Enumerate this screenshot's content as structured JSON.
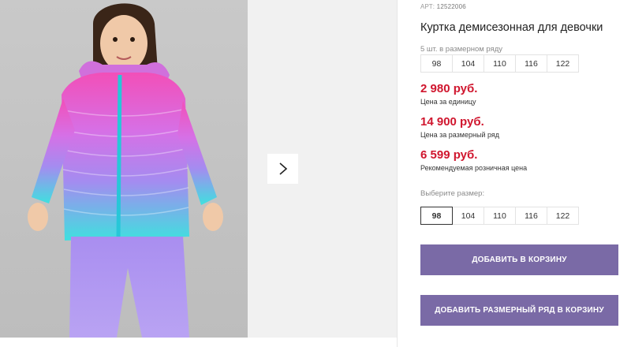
{
  "product": {
    "article_label": "АРТ:",
    "article_number": "12522006",
    "title": "Куртка демисезонная для девочки",
    "size_row_caption": "5 шт. в размерном ряду",
    "size_row": [
      "98",
      "104",
      "110",
      "116",
      "122"
    ],
    "prices": [
      {
        "value": "2 980 руб.",
        "caption": "Цена за единицу"
      },
      {
        "value": "14 900 руб.",
        "caption": "Цена за размерный ряд"
      },
      {
        "value": "6 599 руб.",
        "caption": "Рекомендуемая розничная цена"
      }
    ],
    "choose_size_label": "Выберите размер:",
    "size_options": [
      "98",
      "104",
      "110",
      "116",
      "122"
    ],
    "selected_size": "98",
    "add_to_cart_label": "ДОБАВИТЬ В КОРЗИНУ",
    "add_size_row_label": "ДОБАВИТЬ РАЗМЕРНЫЙ РЯД В КОРЗИНУ"
  },
  "colors": {
    "price": "#d0162e",
    "button": "#7a6aa6",
    "jacket_pink": "#f03fb8",
    "jacket_cyan": "#38e3e0",
    "pants_lilac": "#b79cf0"
  },
  "icons": {
    "next": "chevron-right-icon"
  }
}
